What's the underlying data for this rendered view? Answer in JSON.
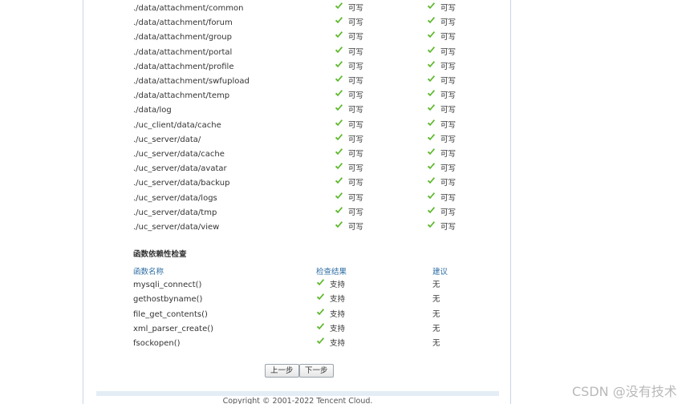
{
  "dirs": [
    {
      "path": "./data/attachment/common",
      "cur": "可写",
      "req": "可写"
    },
    {
      "path": "./data/attachment/forum",
      "cur": "可写",
      "req": "可写"
    },
    {
      "path": "./data/attachment/group",
      "cur": "可写",
      "req": "可写"
    },
    {
      "path": "./data/attachment/portal",
      "cur": "可写",
      "req": "可写"
    },
    {
      "path": "./data/attachment/profile",
      "cur": "可写",
      "req": "可写"
    },
    {
      "path": "./data/attachment/swfupload",
      "cur": "可写",
      "req": "可写"
    },
    {
      "path": "./data/attachment/temp",
      "cur": "可写",
      "req": "可写"
    },
    {
      "path": "./data/log",
      "cur": "可写",
      "req": "可写"
    },
    {
      "path": "./uc_client/data/cache",
      "cur": "可写",
      "req": "可写"
    },
    {
      "path": "./uc_server/data/",
      "cur": "可写",
      "req": "可写"
    },
    {
      "path": "./uc_server/data/cache",
      "cur": "可写",
      "req": "可写"
    },
    {
      "path": "./uc_server/data/avatar",
      "cur": "可写",
      "req": "可写"
    },
    {
      "path": "./uc_server/data/backup",
      "cur": "可写",
      "req": "可写"
    },
    {
      "path": "./uc_server/data/logs",
      "cur": "可写",
      "req": "可写"
    },
    {
      "path": "./uc_server/data/tmp",
      "cur": "可写",
      "req": "可写"
    },
    {
      "path": "./uc_server/data/view",
      "cur": "可写",
      "req": "可写"
    }
  ],
  "func_section": {
    "title": "函数依赖性检查",
    "headers": {
      "name": "函数名称",
      "result": "检查结果",
      "suggest": "建议"
    },
    "rows": [
      {
        "name": "mysqli_connect()",
        "result": "支持",
        "suggest": "无"
      },
      {
        "name": "gethostbyname()",
        "result": "支持",
        "suggest": "无"
      },
      {
        "name": "file_get_contents()",
        "result": "支持",
        "suggest": "无"
      },
      {
        "name": "xml_parser_create()",
        "result": "支持",
        "suggest": "无"
      },
      {
        "name": "fsockopen()",
        "result": "支持",
        "suggest": "无"
      }
    ]
  },
  "buttons": {
    "prev": "上一步",
    "next": "下一步"
  },
  "footer": "Copyright © 2001-2022 Tencent Cloud.",
  "watermark": "CSDN @没有技术",
  "colors": {
    "check": "#5cb82a",
    "header": "#2f6ea3",
    "border": "#c8d6e6"
  },
  "icons": {
    "check": "check-icon"
  }
}
